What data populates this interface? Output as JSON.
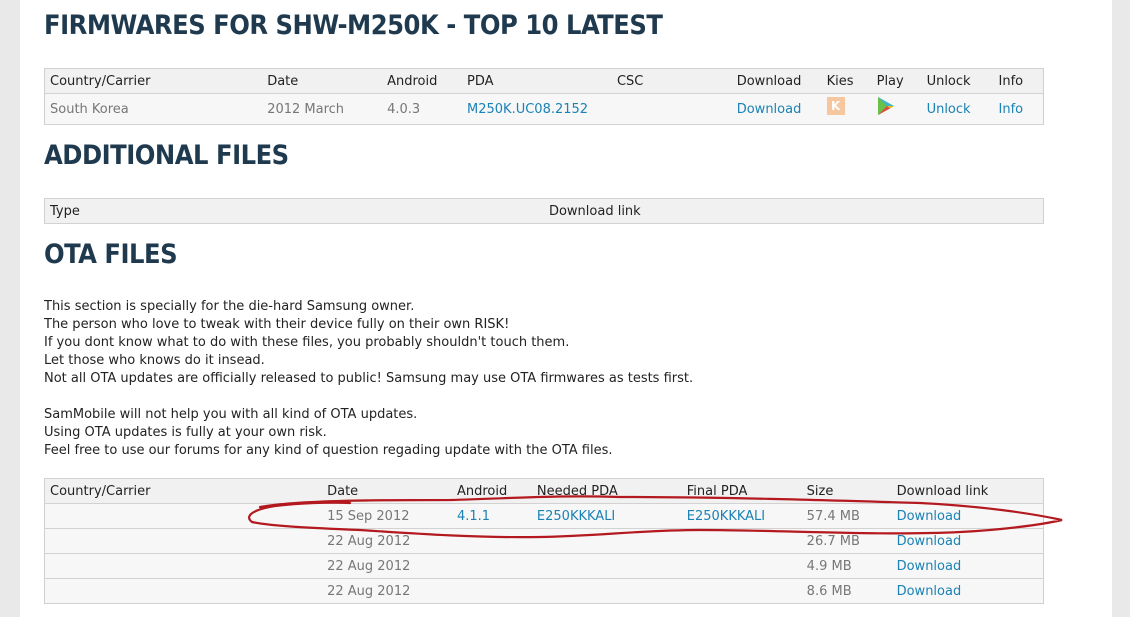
{
  "headings": {
    "firmwares": "FIRMWARES FOR SHW-M250K - TOP 10 LATEST",
    "additional": "ADDITIONAL FILES",
    "ota": "OTA FILES"
  },
  "firmware_table": {
    "headers": [
      "Country/Carrier",
      "Date",
      "Android",
      "PDA",
      "CSC",
      "Download",
      "Kies",
      "Play",
      "Unlock",
      "Info"
    ],
    "rows": [
      {
        "country": "South Korea",
        "date": "2012 March",
        "android": "4.0.3",
        "pda": "M250K.UC08.2152",
        "csc": "",
        "download": "Download",
        "kies_icon": "kies-icon",
        "play_icon": "google-play-icon",
        "unlock": "Unlock",
        "info": "Info"
      }
    ]
  },
  "additional_table": {
    "headers": [
      "Type",
      "Download link"
    ]
  },
  "ota_text": {
    "paragraph1": [
      "This section is specially for the die-hard Samsung owner.",
      "The person who love to tweak with their device fully on their own RISK!",
      "If you dont know what to do with these files, you probably shouldn't touch them.",
      "Let those who knows do it insead.",
      "Not all OTA updates are officially released to public! Samsung may use OTA firmwares as tests first."
    ],
    "paragraph2": [
      "SamMobile will not help you with all kind of OTA updates.",
      "Using OTA updates is fully at your own risk.",
      "Feel free to use our forums for any kind of question regading update with the OTA files."
    ]
  },
  "ota_table": {
    "headers": [
      "Country/Carrier",
      "Date",
      "Android",
      "Needed PDA",
      "Final PDA",
      "Size",
      "Download link"
    ],
    "rows": [
      {
        "country": "",
        "date": "15 Sep 2012",
        "android": "4.1.1",
        "needed_pda": "E250KKKALI",
        "final_pda": "E250KKKALI",
        "size": "57.4 MB",
        "download": "Download"
      },
      {
        "country": "",
        "date": "22 Aug 2012",
        "android": "",
        "needed_pda": "",
        "final_pda": "",
        "size": "26.7 MB",
        "download": "Download"
      },
      {
        "country": "",
        "date": "22 Aug 2012",
        "android": "",
        "needed_pda": "",
        "final_pda": "",
        "size": "4.9 MB",
        "download": "Download"
      },
      {
        "country": "",
        "date": "22 Aug 2012",
        "android": "",
        "needed_pda": "",
        "final_pda": "",
        "size": "8.6 MB",
        "download": "Download"
      }
    ]
  },
  "colors": {
    "heading": "#1f3a4e",
    "link": "#1a82b5",
    "annotation": "#b3191e"
  }
}
